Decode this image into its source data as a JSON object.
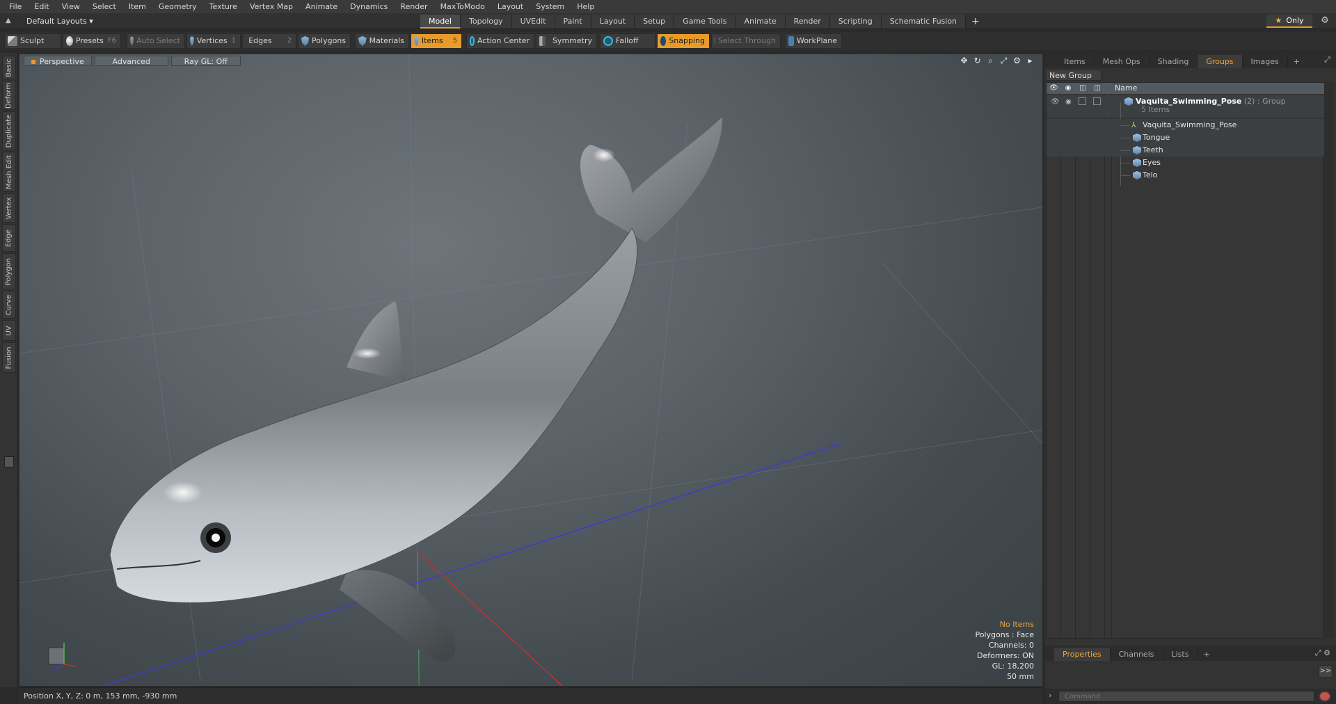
{
  "menu": [
    "File",
    "Edit",
    "View",
    "Select",
    "Item",
    "Geometry",
    "Texture",
    "Vertex Map",
    "Animate",
    "Dynamics",
    "Render",
    "MaxToModo",
    "Layout",
    "System",
    "Help"
  ],
  "layout": {
    "dropdown_label": "Default Layouts ▾",
    "tabs": [
      "Model",
      "Topology",
      "UVEdit",
      "Paint",
      "Layout",
      "Setup",
      "Game Tools",
      "Animate",
      "Render",
      "Scripting",
      "Schematic Fusion"
    ],
    "active_tab": "Model",
    "add_tab": "+",
    "only_label": "Only"
  },
  "toolbar": {
    "sculpt": "Sculpt",
    "presets": "Presets",
    "presets_key": "F6",
    "auto_select": "Auto Select",
    "vertices": "Vertices",
    "vertices_count": "1",
    "edges": "Edges",
    "edges_count": "2",
    "polygons": "Polygons",
    "materials": "Materials",
    "items": "Items",
    "items_count": "5",
    "action_center": "Action Center",
    "symmetry": "Symmetry",
    "falloff": "Falloff",
    "snapping": "Snapping",
    "select_through": "Select Through",
    "workplane": "WorkPlane"
  },
  "left_tabs": [
    "Basic",
    "Deform",
    "Duplicate",
    "Mesh Edit",
    "Vertex",
    "Edge",
    "Polygon",
    "Curve",
    "UV",
    "Fusion"
  ],
  "viewport": {
    "view_mode": "Perspective",
    "shading": "Advanced",
    "raygl": "Ray GL: Off",
    "info": {
      "no_items": "No Items",
      "polygons": "Polygons : Face",
      "channels": "Channels: 0",
      "deformers": "Deformers: ON",
      "gl": "GL: 18,200",
      "size": "50 mm"
    }
  },
  "status": {
    "position": "Position X, Y, Z:  0 m, 153 mm, -930 mm"
  },
  "right_panel": {
    "tabs": [
      "Items",
      "Mesh Ops",
      "Shading",
      "Groups",
      "Images"
    ],
    "active_tab": "Groups",
    "add_tab": "+",
    "new_group": "New Group",
    "column_name": "Name",
    "group": {
      "name": "Vaquita_Swimming_Pose",
      "count": "(2)",
      "type": ": Group",
      "items_label": "5 Items"
    },
    "children": [
      "Vaquita_Swimming_Pose",
      "Tongue",
      "Teeth",
      "Eyes",
      "Telo"
    ]
  },
  "properties": {
    "tabs": [
      "Properties",
      "Channels",
      "Lists"
    ],
    "active_tab": "Properties",
    "add_tab": "+",
    "expand_btn": ">>"
  },
  "command": {
    "placeholder": "Command"
  },
  "colors": {
    "accent": "#e79b2b",
    "viewport_bg": "#5b6369",
    "panel_bg": "#333333"
  }
}
